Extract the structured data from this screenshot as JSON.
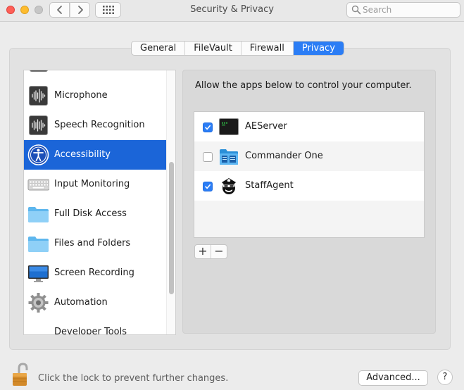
{
  "window": {
    "title": "Security & Privacy",
    "grid_icon": "grid-icon"
  },
  "search": {
    "placeholder": "Search",
    "value": ""
  },
  "tabs": [
    {
      "label": "General",
      "active": false
    },
    {
      "label": "FileVault",
      "active": false
    },
    {
      "label": "Firewall",
      "active": false
    },
    {
      "label": "Privacy",
      "active": true
    }
  ],
  "sidebar": {
    "items": [
      {
        "label": "",
        "icon": "partial-item-icon"
      },
      {
        "label": "Microphone",
        "icon": "microphone-waveform-icon"
      },
      {
        "label": "Speech Recognition",
        "icon": "speech-waveform-icon"
      },
      {
        "label": "Accessibility",
        "icon": "accessibility-icon",
        "selected": true
      },
      {
        "label": "Input Monitoring",
        "icon": "keyboard-icon"
      },
      {
        "label": "Full Disk Access",
        "icon": "folder-icon"
      },
      {
        "label": "Files and Folders",
        "icon": "folder-icon"
      },
      {
        "label": "Screen Recording",
        "icon": "display-icon"
      },
      {
        "label": "Automation",
        "icon": "gear-icon"
      },
      {
        "label": "Developer Tools",
        "icon": "developer-tools-icon"
      }
    ]
  },
  "panel": {
    "description": "Allow the apps below to control your computer.",
    "apps": [
      {
        "name": "AEServer",
        "checked": true,
        "icon": "terminal-icon"
      },
      {
        "name": "Commander One",
        "checked": false,
        "icon": "commander-one-icon"
      },
      {
        "name": "StaffAgent",
        "checked": true,
        "icon": "staffagent-icon"
      }
    ],
    "add_label": "+",
    "remove_label": "−"
  },
  "footer": {
    "lock_text": "Click the lock to prevent further changes.",
    "advanced_label": "Advanced...",
    "help_label": "?"
  },
  "colors": {
    "accent": "#2b7df5",
    "selection": "#1b65d8",
    "close": "#fe5f57",
    "minimize": "#febc2e"
  }
}
